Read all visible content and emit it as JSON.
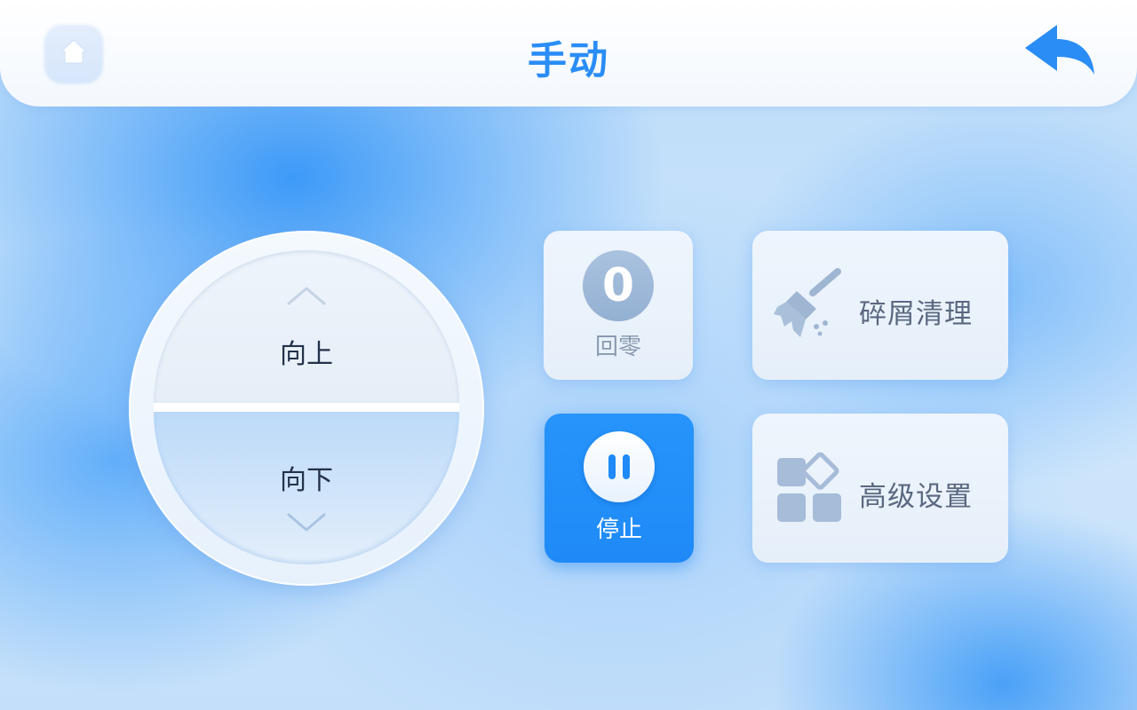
{
  "header": {
    "title": "手动",
    "home_icon": "home-icon",
    "back_icon": "back-arrow-icon"
  },
  "dial": {
    "up_label": "向上",
    "down_label": "向下",
    "up_icon": "chevron-up-icon",
    "down_icon": "chevron-down-icon"
  },
  "actions": {
    "zero": {
      "glyph": "0",
      "label": "回零"
    },
    "stop": {
      "label": "停止",
      "icon": "pause-icon"
    },
    "debris": {
      "label": "碎屑清理",
      "icon": "broom-icon"
    },
    "advanced": {
      "label": "高级设置",
      "icon": "apps-grid-icon"
    }
  },
  "colors": {
    "accent": "#2a8df5",
    "stop_bg": "#1f8af7",
    "card_bg": "#eef5fd",
    "muted_icon": "#9fb6d3",
    "label_text": "#5a6880"
  }
}
